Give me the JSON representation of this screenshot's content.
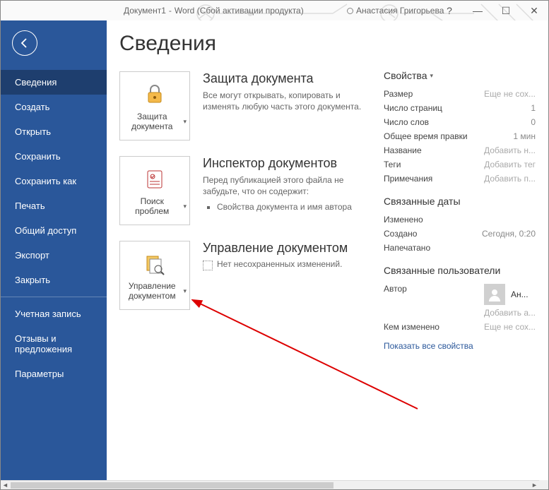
{
  "titlebar": {
    "doc": "Документ1",
    "sep": "-",
    "app": "Word (Сбой активации продукта)",
    "user": "Анастасия Григорьева",
    "help": "?",
    "min": "—",
    "max": "☐",
    "close": "✕"
  },
  "sidebar": {
    "items": [
      {
        "label": "Сведения",
        "selected": true
      },
      {
        "label": "Создать"
      },
      {
        "label": "Открыть"
      },
      {
        "label": "Сохранить"
      },
      {
        "label": "Сохранить как"
      },
      {
        "label": "Печать"
      },
      {
        "label": "Общий доступ"
      },
      {
        "label": "Экспорт"
      },
      {
        "label": "Закрыть"
      }
    ],
    "footer": [
      {
        "label": "Учетная запись"
      },
      {
        "label": "Отзывы и предложения"
      },
      {
        "label": "Параметры"
      }
    ]
  },
  "page": {
    "title": "Сведения",
    "protect": {
      "btn": "Защита документа",
      "title": "Защита документа",
      "desc": "Все могут открывать, копировать и изменять любую часть этого документа."
    },
    "inspect": {
      "btn": "Поиск проблем",
      "title": "Инспектор документов",
      "desc": "Перед публикацией этого файла не забудьте, что он содержит:",
      "bullets": [
        "Свойства документа и имя автора"
      ]
    },
    "manage": {
      "btn": "Управление документом",
      "title": "Управление документом",
      "nochanges": "Нет несохраненных изменений."
    }
  },
  "props": {
    "header": "Свойства",
    "rows": [
      {
        "label": "Размер",
        "value": "Еще не сох..."
      },
      {
        "label": "Число страниц",
        "value": "1"
      },
      {
        "label": "Число слов",
        "value": "0"
      },
      {
        "label": "Общее время правки",
        "value": "1 мин"
      },
      {
        "label": "Название",
        "value": "Добавить н..."
      },
      {
        "label": "Теги",
        "value": "Добавить тег"
      },
      {
        "label": "Примечания",
        "value": "Добавить п..."
      }
    ],
    "dates_header": "Связанные даты",
    "dates": [
      {
        "label": "Изменено",
        "value": ""
      },
      {
        "label": "Создано",
        "value": "Сегодня, 0:20"
      },
      {
        "label": "Напечатано",
        "value": ""
      }
    ],
    "users_header": "Связанные пользователи",
    "author_label": "Автор",
    "author_name": "Ан...",
    "add_author": "Добавить а...",
    "changed_by_label": "Кем изменено",
    "changed_by_value": "Еще не сох...",
    "show_all": "Показать все свойства"
  }
}
